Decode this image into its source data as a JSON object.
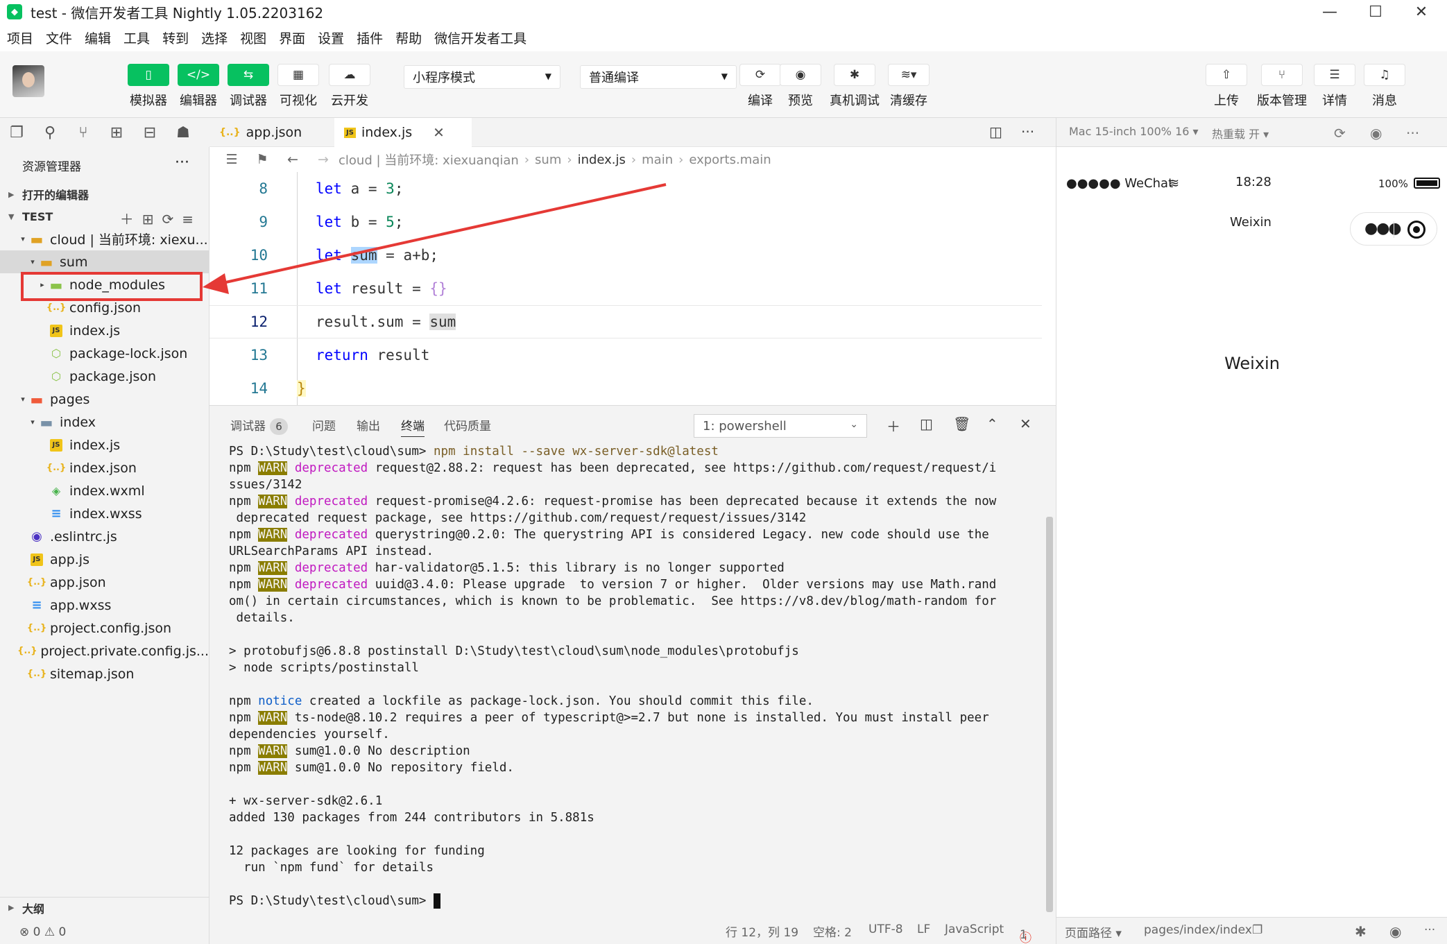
{
  "window": {
    "title": "test - 微信开发者工具 Nightly 1.05.2203162",
    "minimize": "—",
    "maximize": "☐",
    "close": "✕"
  },
  "menu": [
    "项目",
    "文件",
    "编辑",
    "工具",
    "转到",
    "选择",
    "视图",
    "界面",
    "设置",
    "插件",
    "帮助",
    "微信开发者工具"
  ],
  "toolbar": {
    "simulator": "模拟器",
    "editor": "编辑器",
    "debugger": "调试器",
    "visual": "可视化",
    "cloud": "云开发",
    "mode_select": "小程序模式",
    "compile_select": "普通编译",
    "compile": "编译",
    "preview": "预览",
    "real_debug": "真机调试",
    "clear_cache": "清缓存",
    "upload": "上传",
    "version": "版本管理",
    "details": "详情",
    "messages": "消息"
  },
  "explorer": {
    "title": "资源管理器",
    "more": "···",
    "open_editors": "打开的编辑器",
    "project": "TEST",
    "outline": "大纲",
    "tree": [
      {
        "label": "cloud | 当前环境: xiexu...",
        "icon": "folder-icon",
        "depth": 1,
        "twisty": "▾"
      },
      {
        "label": "sum",
        "icon": "folder-icon",
        "depth": 2,
        "twisty": "▾"
      },
      {
        "label": "node_modules",
        "icon": "folder-green-icon",
        "depth": 3,
        "twisty": "▸"
      },
      {
        "label": "config.json",
        "icon": "json-icon",
        "depth": 3,
        "twisty": ""
      },
      {
        "label": "index.js",
        "icon": "js-icon",
        "depth": 3,
        "twisty": ""
      },
      {
        "label": "package-lock.json",
        "icon": "npm-icon",
        "depth": 3,
        "twisty": ""
      },
      {
        "label": "package.json",
        "icon": "npm-icon",
        "depth": 3,
        "twisty": ""
      },
      {
        "label": "pages",
        "icon": "folder-red-icon",
        "depth": 1,
        "twisty": "▾"
      },
      {
        "label": "index",
        "icon": "folder-blue-icon",
        "depth": 2,
        "twisty": "▾"
      },
      {
        "label": "index.js",
        "icon": "js-icon",
        "depth": 3,
        "twisty": ""
      },
      {
        "label": "index.json",
        "icon": "json-icon",
        "depth": 3,
        "twisty": ""
      },
      {
        "label": "index.wxml",
        "icon": "wxml-icon",
        "depth": 3,
        "twisty": ""
      },
      {
        "label": "index.wxss",
        "icon": "css-icon",
        "depth": 3,
        "twisty": ""
      },
      {
        "label": ".eslintrc.js",
        "icon": "eslint-icon",
        "depth": 1,
        "twisty": ""
      },
      {
        "label": "app.js",
        "icon": "js-icon",
        "depth": 1,
        "twisty": ""
      },
      {
        "label": "app.json",
        "icon": "json-icon",
        "depth": 1,
        "twisty": ""
      },
      {
        "label": "app.wxss",
        "icon": "css-icon",
        "depth": 1,
        "twisty": ""
      },
      {
        "label": "project.config.json",
        "icon": "json-icon",
        "depth": 1,
        "twisty": ""
      },
      {
        "label": "project.private.config.js...",
        "icon": "json-icon",
        "depth": 1,
        "twisty": ""
      },
      {
        "label": "sitemap.json",
        "icon": "json-icon",
        "depth": 1,
        "twisty": ""
      }
    ],
    "status": "⊗ 0 ⚠ 0"
  },
  "editor": {
    "tabs": [
      {
        "label": "app.json",
        "icon": "{..}"
      },
      {
        "label": "index.js",
        "icon": "JS"
      }
    ],
    "breadcrumb": [
      "cloud | 当前环境: xiexuanqian",
      "sum",
      "index.js",
      "main",
      "exports.main"
    ],
    "lines": [
      "8",
      "9",
      "10",
      "11",
      "12",
      "13",
      "14"
    ]
  },
  "panel": {
    "tabs": [
      "调试器",
      "问题",
      "输出",
      "终端",
      "代码质量"
    ],
    "debugger_count": "6",
    "terminal_select": "1: powershell",
    "terminal": {
      "prompt1": "PS D:\\Study\\test\\cloud\\sum> ",
      "cmd1": "npm install --save wx-server-sdk@latest",
      "npm": "npm",
      "warn": "WARN",
      "deprecated": "deprecated",
      "notice": "notice",
      "w1a": " request@2.88.2: request has been deprecated, see https://github.com/request/request/i",
      "w1b": "ssues/3142",
      "w2a": " request-promise@4.2.6: request-promise has been deprecated because it extends the now",
      "w2b": " deprecated request package, see https://github.com/request/request/issues/3142",
      "w3a": " querystring@0.2.0: The querystring API is considered Legacy. new code should use the",
      "w3b": "URLSearchParams API instead.",
      "w4": " har-validator@5.1.5: this library is no longer supported",
      "w5a": " uuid@3.4.0: Please upgrade  to version 7 or higher.  Older versions may use Math.rand",
      "w5b": "om() in certain circumstances, which is known to be problematic.  See https://v8.dev/blog/math-random for",
      "w5c": " details.",
      "pb1": "> protobufjs@6.8.8 postinstall D:\\Study\\test\\cloud\\sum\\node_modules\\protobufjs",
      "pb2": "> node scripts/postinstall",
      "n1": " created a lockfile as package-lock.json. You should commit this file.",
      "w6a": " ts-node@8.10.2 requires a peer of typescript@>=2.7 but none is installed. You must install peer",
      "w6b": "dependencies yourself.",
      "w7": " sum@1.0.0 No description",
      "w8": " sum@1.0.0 No repository field.",
      "r1": "+ wx-server-sdk@2.6.1",
      "r2": "added 130 packages from 244 contributors in 5.881s",
      "f1": "12 packages are looking for funding",
      "f2": "  run `npm fund` for details",
      "prompt2": "PS D:\\Study\\test\\cloud\\sum> "
    }
  },
  "statusbar": {
    "position": "行 12，列 19",
    "spaces": "空格: 2",
    "encoding": "UTF-8",
    "eol": "LF",
    "language": "JavaScript",
    "errors": "1"
  },
  "simulator": {
    "device": "Mac 15-inch 100% 16 ▾",
    "hotreload": "热重载 开 ▾",
    "carrier": "●●●●● WeChat",
    "time": "18:28",
    "battery": "100%",
    "nav_title": "Weixin",
    "page_text": "Weixin",
    "page_path_label": "页面路径 ▾",
    "page_path": "pages/index/index"
  }
}
